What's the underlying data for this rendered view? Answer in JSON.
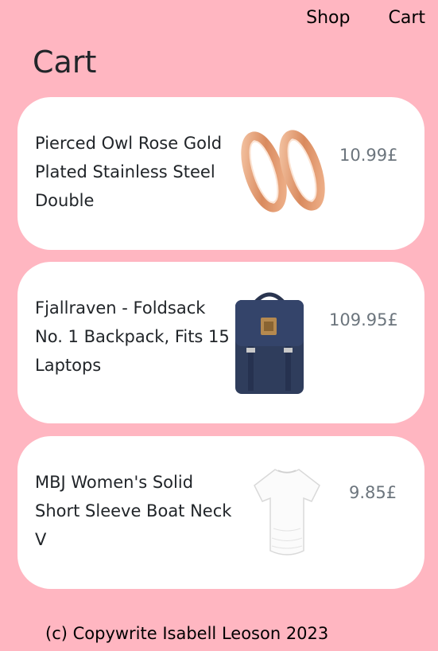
{
  "nav": {
    "shop_label": "Shop",
    "cart_label": "Cart"
  },
  "page": {
    "title": "Cart"
  },
  "items": [
    {
      "title": "Pierced Owl Rose Gold Plated Stainless Steel Double",
      "price": "10.99£",
      "icon": "rose-gold-ear-tunnels-image"
    },
    {
      "title": "Fjallraven - Foldsack No. 1 Backpack, Fits 15 Laptops",
      "price": "109.95£",
      "icon": "navy-backpack-image"
    },
    {
      "title": "MBJ Women's Solid Short Sleeve Boat Neck V",
      "price": "9.85£",
      "icon": "white-tshirt-image"
    }
  ],
  "footer": {
    "copyright": "(c) Copywrite Isabell Leoson 2023"
  },
  "colors": {
    "background": "#ffb6c1",
    "card": "#ffffff",
    "price": "#6c757d"
  }
}
